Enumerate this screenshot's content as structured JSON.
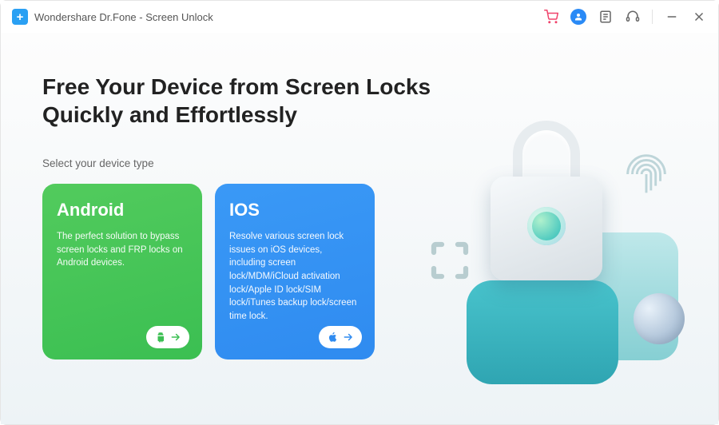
{
  "titlebar": {
    "title": "Wondershare Dr.Fone - Screen Unlock"
  },
  "main": {
    "headline_line1": "Free Your Device from Screen Locks",
    "headline_line2": "Quickly and Effortlessly",
    "subhead": "Select your device type"
  },
  "cards": {
    "android": {
      "title": "Android",
      "desc": "The perfect solution to bypass screen locks and FRP locks on Android devices."
    },
    "ios": {
      "title": "IOS",
      "desc": "Resolve various screen lock issues on iOS devices, including screen lock/MDM/iCloud activation lock/Apple ID lock/SIM lock/iTunes backup lock/screen time lock."
    }
  }
}
